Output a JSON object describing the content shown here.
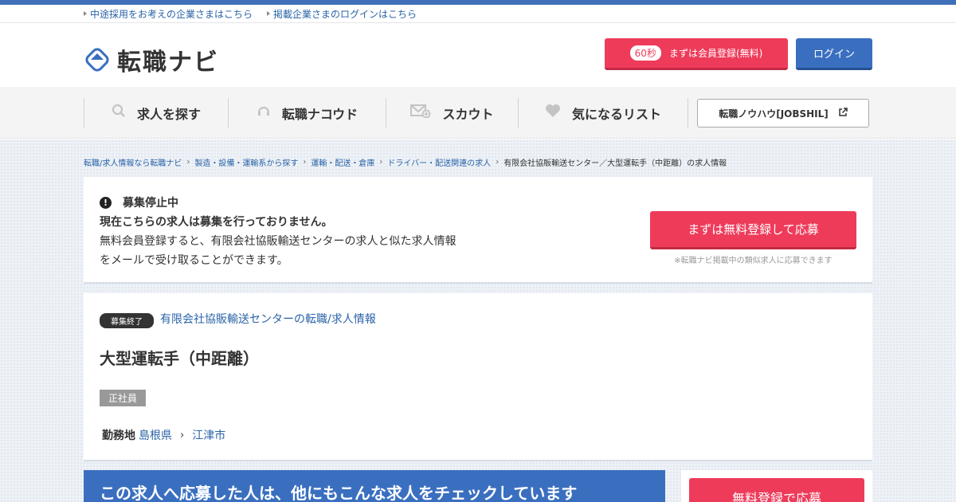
{
  "util": {
    "links": [
      "中途採用をお考えの企業さまはこちら",
      "掲載企業さまのログインはこちら"
    ]
  },
  "header": {
    "logo_text": "転職ナビ",
    "register_badge": "60秒",
    "register_label": "まずは会員登録(無料)",
    "login_label": "ログイン"
  },
  "nav": {
    "items": [
      {
        "label": "求人を探す",
        "icon": "search-icon"
      },
      {
        "label": "転職ナコウド",
        "icon": "headset-icon"
      },
      {
        "label": "スカウト",
        "icon": "mail-icon"
      },
      {
        "label": "気になるリスト",
        "icon": "heart-icon"
      }
    ],
    "knowhow_label": "転職ノウハウ[JOBSHIL]"
  },
  "breadcrumb": [
    "転職/求人情報なら転職ナビ",
    "製造・設備・運輸系から探す",
    "運輸・配送・倉庫",
    "ドライバー・配送関連の求人",
    "有限会社協販輸送センター／大型運転手（中距離）の求人情報"
  ],
  "notice": {
    "heading": "募集停止中",
    "line1": "現在こちらの求人は募集を行っておりません。",
    "line2": "無料会員登録すると、有限会社協販輸送センターの求人と似た求人情報",
    "line3": "をメールで受け取ることができます。",
    "apply_label": "まずは無料登録して応募",
    "note": "※転職ナビ掲載中の類似求人に応募できます"
  },
  "job": {
    "status_tag": "募集終了",
    "company_link": "有限会社協販輸送センターの転職/求人情報",
    "title": "大型運転手（中距離）",
    "employment_type": "正社員",
    "location_label": "勤務地",
    "prefecture": "島根県",
    "city": "江津市"
  },
  "related": {
    "banner": "この求人へ応募した人は、他にもこんな求人をチェックしています",
    "side_button": "無料登録で応募"
  },
  "colors": {
    "accent_red": "#ee3b5a",
    "brand_blue": "#3a6fc0"
  }
}
